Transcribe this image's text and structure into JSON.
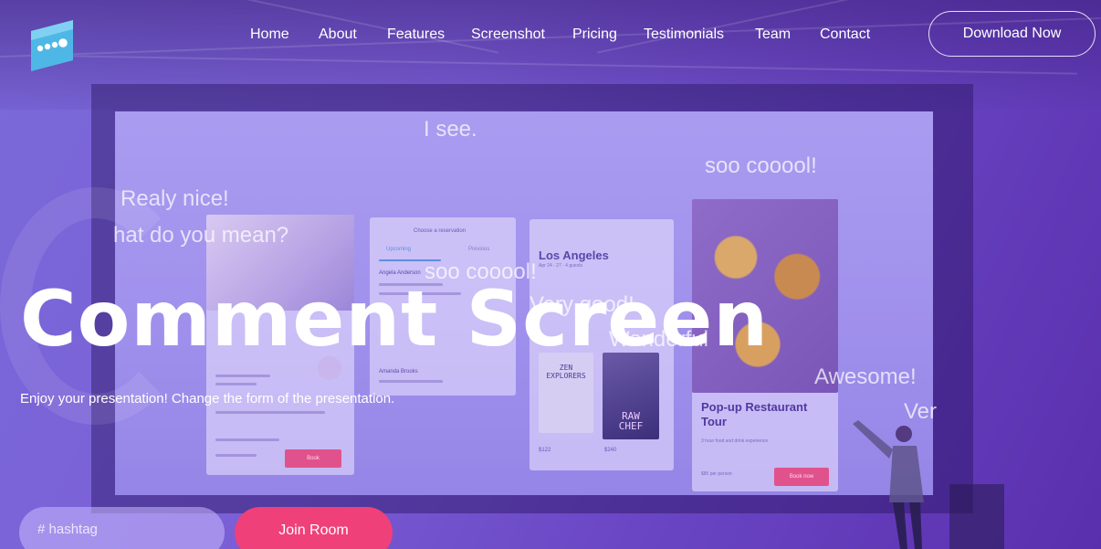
{
  "nav": {
    "logo_icon": "speech-bubble-dots-icon",
    "items": [
      "Home",
      "About",
      "Features",
      "Screenshot",
      "Pricing",
      "Testimonials",
      "Team",
      "Contact"
    ],
    "download_label": "Download Now"
  },
  "hero": {
    "title": "Comment Screen",
    "subtitle": "Enjoy your presentation! Change the form of the presentation.",
    "hashtag_placeholder": "# hashtag",
    "join_label": "Join Room"
  },
  "comments": [
    "I see.",
    "soo cooool!",
    "Realy nice!",
    "hat do you mean?",
    "soo cooool!",
    "Very good!",
    "Wonderful",
    "Awesome!",
    "Ver"
  ],
  "screen_content": {
    "card1": {
      "title": "Loft with Ocean View and Kitchen",
      "meta": "Entire home",
      "host": "Hosted by Gloria",
      "stats": "4 guests  2 rooms  3 beds  1.5 bath",
      "about": "About this home",
      "price": "$160 per person",
      "button": "Book"
    },
    "card2": {
      "header": "Choose a reservation",
      "tab1": "Upcoming",
      "tab2": "Previous",
      "person1": "Angela Anderson",
      "person2": "Amanda Brooks",
      "guests": "3 guests · Apr 22-24"
    },
    "card3": {
      "title": "Los Angeles",
      "sub": "Apr 24 - 27 · 4 guests",
      "book1": "ZEN EXPLORERS",
      "book2": "RAW CHEF",
      "price1": "$122",
      "price2": "$240"
    },
    "card4": {
      "title": "Pop-up Restaurant Tour",
      "sub": "3 hour food and drink experience",
      "host": "Hosted by Paolo",
      "price": "$85 per person",
      "button": "Book now"
    }
  },
  "colors": {
    "accent": "#f0407a",
    "background_start": "#7a6ad9",
    "background_end": "#5a2fae",
    "logo": "#4fb7e6"
  }
}
